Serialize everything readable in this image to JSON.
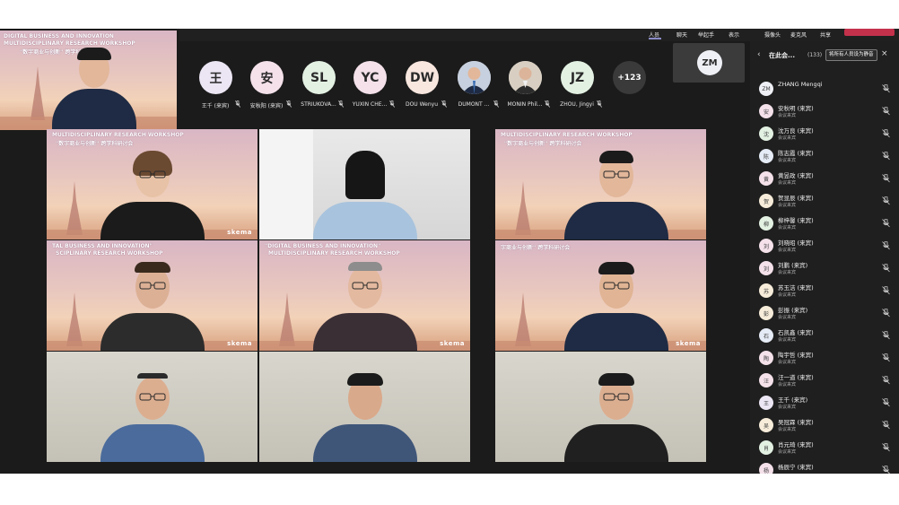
{
  "toolbar": {
    "items": [
      "人员",
      "聊天",
      "举起手",
      "表示"
    ],
    "right_items": [
      "摄像头",
      "麦克风",
      "共享"
    ],
    "leave_label": ""
  },
  "speaker_preview": {
    "line1": "DIGITAL BUSINESS AND INNOVATION",
    "line2": "MULTIDISCIPLINARY RESEARCH WORKSHOP",
    "line3": "\"数字商业与创新\" 跨学科研讨会"
  },
  "avatar_strip": [
    {
      "initials": "王",
      "name": "王千 (来宾)",
      "color": "#ece6f4"
    },
    {
      "initials": "安",
      "name": "安秋阳 (来宾)",
      "color": "#f4e1ea"
    },
    {
      "initials": "SL",
      "name": "STRIUKOVA...",
      "color": "#e3f1e3"
    },
    {
      "initials": "YC",
      "name": "YUXIN CHE...",
      "color": "#f4e1ea"
    },
    {
      "initials": "DW",
      "name": "DOU Wenyu",
      "color": "#f8e7df"
    },
    {
      "initials": "",
      "name": "DUMONT ...",
      "color": "#cfd6e2",
      "photo": true
    },
    {
      "initials": "",
      "name": "MONIN Phil...",
      "color": "#d9d0c4",
      "photo": true
    },
    {
      "initials": "JZ",
      "name": "ZHOU, Jingyi",
      "color": "#e3f1e3"
    },
    {
      "initials": "+123",
      "name": "",
      "color": "#3a3a3a",
      "more": true
    }
  ],
  "self_tile": {
    "initials": "ZM"
  },
  "grid": {
    "tiles": [
      {
        "bg": "skema",
        "text_top": "MULTIDISCIPLINARY RESEARCH WORKSHOP",
        "text_sub": "\"数字商业与创新\" 跨学科研讨会",
        "brand": "skema"
      },
      {
        "bg": "room",
        "text_top": "",
        "text_sub": "",
        "brand": ""
      },
      {
        "bg": "skema",
        "text_top": "MULTIDISCIPLINARY RESEARCH WORKSHOP",
        "text_sub": "\"数字商业与创新\" 跨学科研讨会",
        "brand": ""
      },
      {
        "bg": "skema",
        "text_top": "TAL BUSINESS AND INNOVATION\"",
        "text_sub": "SCIPLINARY RESEARCH WORKSHOP",
        "brand": "skema"
      },
      {
        "bg": "skema",
        "text_top": "\"DIGITAL BUSINESS AND INNOVATION\"",
        "text_sub": "MULTIDISCIPLINARY RESEARCH WORKSHOP",
        "brand": "skema"
      },
      {
        "bg": "skema",
        "text_top": "字商业与创新\" 跨学科研讨会",
        "text_sub": "",
        "brand": "skema"
      },
      {
        "bg": "wall",
        "text_top": "",
        "text_sub": "",
        "brand": ""
      },
      {
        "bg": "wall",
        "text_top": "",
        "text_sub": "",
        "brand": ""
      },
      {
        "bg": "wall",
        "text_top": "",
        "text_sub": "",
        "brand": ""
      }
    ]
  },
  "sidebar": {
    "back_glyph": "‹",
    "title": "在此会...",
    "count": "(133)",
    "mute_all": "将所有人员设为静音",
    "close_glyph": "×",
    "participants": [
      {
        "initials": "ZM",
        "name": "ZHANG Mengqi",
        "role": "",
        "color": "#eef0f6"
      },
      {
        "initials": "安",
        "name": "安秋明 (来宾)",
        "role": "会议来宾",
        "color": "#f4e1ea"
      },
      {
        "initials": "沈",
        "name": "沈万良 (来宾)",
        "role": "会议来宾",
        "color": "#e3f1e3"
      },
      {
        "initials": "陈",
        "name": "陈志霞 (来宾)",
        "role": "会议来宾",
        "color": "#e6ecf6"
      },
      {
        "initials": "黄",
        "name": "黄昱政 (来宾)",
        "role": "会议来宾",
        "color": "#f4e1ea"
      },
      {
        "initials": "贺",
        "name": "贺显辰 (来宾)",
        "role": "会议来宾",
        "color": "#f6ecd9"
      },
      {
        "initials": "柳",
        "name": "柳梓馨 (来宾)",
        "role": "会议来宾",
        "color": "#e3f1e3"
      },
      {
        "initials": "刘",
        "name": "刘晓昭 (来宾)",
        "role": "会议来宾",
        "color": "#f4e1ea"
      },
      {
        "initials": "刘",
        "name": "刘鹏 (来宾)",
        "role": "会议来宾",
        "color": "#f4e1ea"
      },
      {
        "initials": "苏",
        "name": "苏玉洁 (来宾)",
        "role": "会议来宾",
        "color": "#f6ecd9"
      },
      {
        "initials": "彭",
        "name": "彭振 (来宾)",
        "role": "会议来宾",
        "color": "#f6ecd9"
      },
      {
        "initials": "石",
        "name": "石凯鑫 (来宾)",
        "role": "会议来宾",
        "color": "#e6ecf6"
      },
      {
        "initials": "陶",
        "name": "陶宇哲 (来宾)",
        "role": "会议来宾",
        "color": "#f4e1ea"
      },
      {
        "initials": "汪",
        "name": "汪一道 (来宾)",
        "role": "会议来宾",
        "color": "#f4e1ea"
      },
      {
        "initials": "王",
        "name": "王千 (来宾)",
        "role": "会议来宾",
        "color": "#ece6f4"
      },
      {
        "initials": "吴",
        "name": "吴冠霖 (来宾)",
        "role": "会议来宾",
        "color": "#f6ecd9"
      },
      {
        "initials": "肖",
        "name": "肖元琦 (来宾)",
        "role": "会议来宾",
        "color": "#e3f1e3"
      },
      {
        "initials": "杨",
        "name": "杨辰宁 (来宾)",
        "role": "",
        "color": "#f4e1ea"
      }
    ]
  }
}
